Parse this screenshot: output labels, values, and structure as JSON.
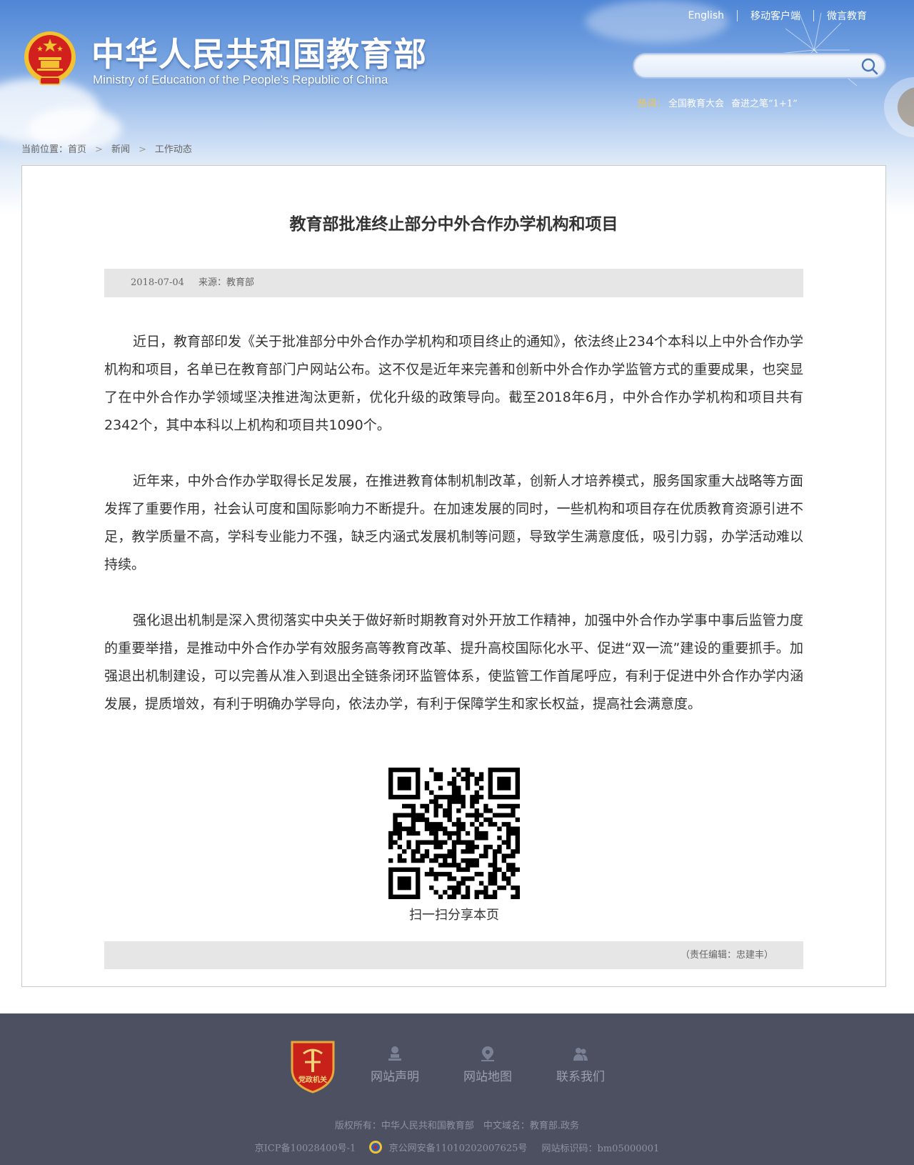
{
  "header": {
    "top_links": [
      "English",
      "移动客户端",
      "微言教育"
    ],
    "site_title_cn": "中华人民共和国教育部",
    "site_title_en": "Ministry of Education of the People's Republic of China",
    "search": {
      "value": "",
      "placeholder": ""
    },
    "hot_label": "热词：",
    "hot_words": [
      "全国教育大会",
      "奋进之笔“1+1”"
    ],
    "breadcrumb": {
      "prefix": "当前位置：",
      "items": [
        "首页",
        "新闻",
        "工作动态"
      ],
      "separator": ">"
    }
  },
  "article": {
    "title": "教育部批准终止部分中外合作办学机构和项目",
    "date": "2018-07-04",
    "source": "来源：教育部",
    "paragraphs": [
      "近日，教育部印发《关于批准部分中外合作办学机构和项目终止的通知》，依法终止234个本科以上中外合作办学机构和项目，名单已在教育部门户网站公布。这不仅是近年来完善和创新中外合作办学监管方式的重要成果，也突显了在中外合作办学领域坚决推进淘汰更新，优化升级的政策导向。截至2018年6月，中外合作办学机构和项目共有2342个，其中本科以上机构和项目共1090个。",
      "近年来，中外合作办学取得长足发展，在推进教育体制机制改革，创新人才培养模式，服务国家重大战略等方面发挥了重要作用，社会认可度和国际影响力不断提升。在加速发展的同时，一些机构和项目存在优质教育资源引进不足，教学质量不高，学科专业能力不强，缺乏内涵式发展机制等问题，导致学生满意度低，吸引力弱，办学活动难以持续。",
      "强化退出机制是深入贯彻落实中央关于做好新时期教育对外开放工作精神，加强中外合作办学事中事后监管力度的重要举措，是推动中外合作办学有效服务高等教育改革、提升高校国际化水平、促进“双一流”建设的重要抓手。加强退出机制建设，可以完善从准入到退出全链条闭环监管体系，使监管工作首尾呼应，有利于促进中外合作办学内涵发展，提质增效，有利于明确办学导向，依法办学，有利于保障学生和家长权益，提高社会满意度。"
    ],
    "qr_caption": "扫一扫分享本页",
    "editor": "（责任编辑：忠建丰）"
  },
  "footer": {
    "badge_text": "党政机关",
    "links": [
      "网站声明",
      "网站地图",
      "联系我们"
    ],
    "copyright": "版权所有：中华人民共和国教育部　中文域名：教育部.政务",
    "icp": "京ICP备10028400号-1",
    "police": "京公网安备11010202007625号",
    "site_id": "网站标识码：bm05000001"
  },
  "colors": {
    "header_blue": "#4f86d6",
    "hot_label": "#f4c542",
    "footer_bg": "#4c5061",
    "meta_bar_bg": "#e6e6e6",
    "emblem_red": "#d2201f",
    "emblem_gold": "#f2c230"
  },
  "icons": {
    "emblem": "national-emblem-icon",
    "search": "search-icon",
    "party_badge": "party-government-badge-icon",
    "statement": "user-stamp-icon",
    "sitemap": "map-pin-icon",
    "contact": "people-icon",
    "police": "police-badge-icon"
  }
}
